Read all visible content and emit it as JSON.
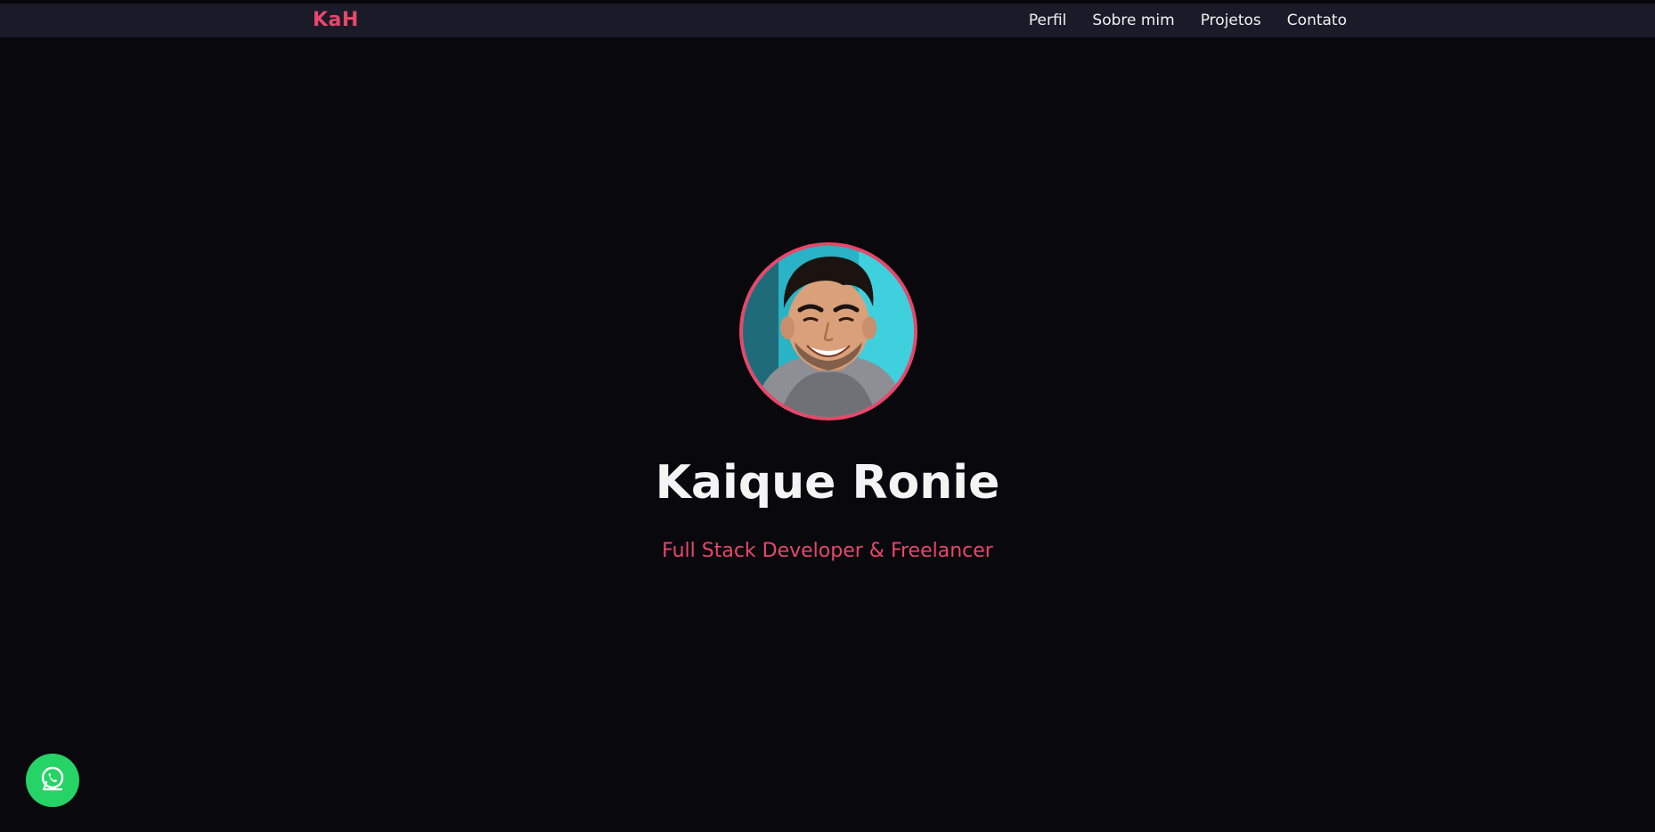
{
  "header": {
    "logo": "KaH",
    "nav": [
      {
        "label": "Perfil"
      },
      {
        "label": "Sobre mim"
      },
      {
        "label": "Projetos"
      },
      {
        "label": "Contato"
      }
    ]
  },
  "hero": {
    "name": "Kaique Ronie",
    "subtitle": "Full Stack Developer & Freelancer",
    "avatar_alt": "Kaique Ronie profile photo"
  },
  "floating": {
    "whatsapp_icon": "whatsapp-icon"
  },
  "colors": {
    "accent": "#e8476a",
    "background": "#08080d",
    "header_bg": "#1a1a28",
    "whatsapp": "#25d366"
  }
}
